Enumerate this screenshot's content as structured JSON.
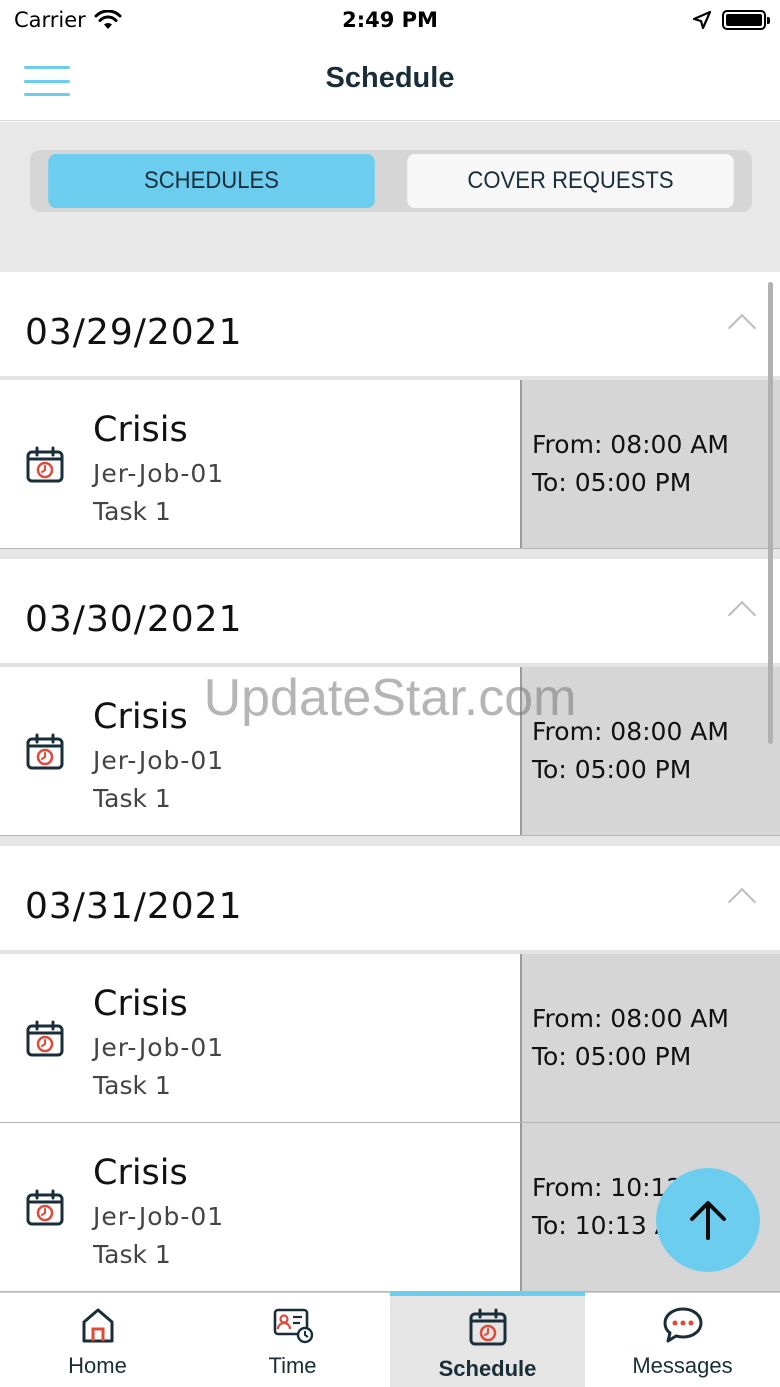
{
  "status_bar": {
    "carrier": "Carrier",
    "time": "2:49 PM"
  },
  "header": {
    "title": "Schedule"
  },
  "segments": {
    "schedules": "SCHEDULES",
    "cover_requests": "COVER REQUESTS"
  },
  "sections": [
    {
      "date": "03/29/2021",
      "rows": [
        {
          "title": "Crisis",
          "job": "Jer-Job-01",
          "task": "Task 1",
          "from": "From: 08:00 AM",
          "to": "To: 05:00 PM"
        }
      ]
    },
    {
      "date": "03/30/2021",
      "rows": [
        {
          "title": "Crisis",
          "job": "Jer-Job-01",
          "task": "Task 1",
          "from": "From: 08:00 AM",
          "to": "To: 05:00 PM"
        }
      ]
    },
    {
      "date": "03/31/2021",
      "rows": [
        {
          "title": "Crisis",
          "job": "Jer-Job-01",
          "task": "Task 1",
          "from": "From: 08:00 AM",
          "to": "To: 05:00 PM"
        },
        {
          "title": "Crisis",
          "job": "Jer-Job-01",
          "task": "Task 1",
          "from": "From: 10:12",
          "to": "To: 10:13 A"
        }
      ]
    }
  ],
  "watermark": "UpdateStar.com",
  "tabs": {
    "home": "Home",
    "time": "Time",
    "schedule": "Schedule",
    "messages": "Messages"
  },
  "colors": {
    "accent": "#6ccdee",
    "icon_dark": "#1a2e3a",
    "icon_red": "#e04a3a"
  }
}
